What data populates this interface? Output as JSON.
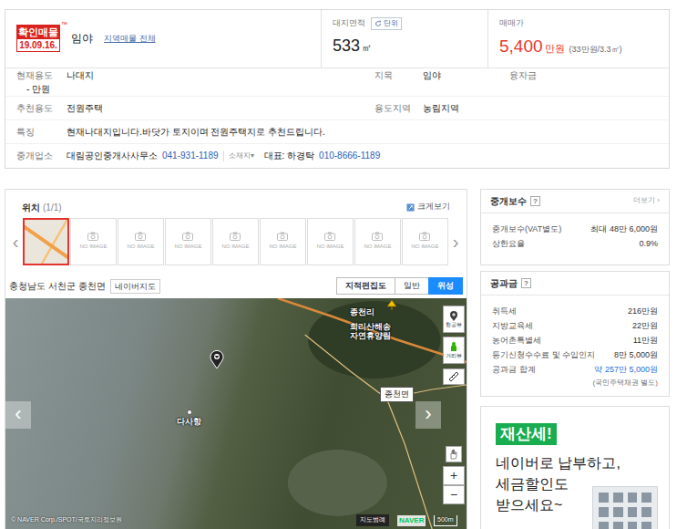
{
  "listing": {
    "badge_title": "확인매물",
    "badge_tm": "™",
    "badge_date": "19.09.16.",
    "type": "임야",
    "area_link": "지역매물 전체",
    "area_label": "대지면적",
    "unit_button": "단위",
    "area_value": "533",
    "area_unit": "㎡",
    "price_label": "매매가",
    "price_value": "5,400",
    "price_unit": "만원",
    "price_per": "(33만원/3.3㎡)"
  },
  "details": {
    "rows": [
      {
        "kind": "pairs",
        "cells": [
          {
            "label": "현재용도",
            "value": "나대지"
          },
          {
            "label": "지목",
            "value": "임야"
          },
          {
            "label": "융자금",
            "value": "- 만원"
          }
        ]
      },
      {
        "kind": "pairs",
        "cells": [
          {
            "label": "추천용도",
            "value": "전원주택"
          },
          {
            "label": "용도지역",
            "value": "농림지역"
          }
        ]
      },
      {
        "kind": "text",
        "label": "특징",
        "value": "현재나대지입니다.바닷가 토지이며 전원주택지로 추천드립니다."
      },
      {
        "kind": "agency",
        "label": "중개업소",
        "name": "대림공인중개사사무소",
        "phone": "041-931-1189",
        "location": "소재지",
        "location_arrow": "▾",
        "rep": "대표: 하경탁",
        "rep_phone": "010-8666-1189"
      }
    ]
  },
  "location": {
    "title": "위치",
    "count": "(1/1)",
    "enlarge": "크게보기",
    "prev": "‹",
    "next": "›",
    "thumbnails": [
      {
        "kind": "map",
        "selected": true
      },
      {
        "kind": "empty",
        "label": "NO IMAGE",
        "selected": false
      },
      {
        "kind": "empty",
        "label": "NO IMAGE",
        "selected": false
      },
      {
        "kind": "empty",
        "label": "NO IMAGE",
        "selected": false
      },
      {
        "kind": "empty",
        "label": "NO IMAGE",
        "selected": false
      },
      {
        "kind": "empty",
        "label": "NO IMAGE",
        "selected": false
      },
      {
        "kind": "empty",
        "label": "NO IMAGE",
        "selected": false
      },
      {
        "kind": "empty",
        "label": "NO IMAGE",
        "selected": false
      },
      {
        "kind": "empty",
        "label": "NO IMAGE",
        "selected": false
      }
    ],
    "address": "충청남도 서천군 종천면",
    "naver_map": "네이버지도",
    "map_types": [
      {
        "label": "지적편집도",
        "selected": false
      },
      {
        "label": "일반",
        "selected": false
      },
      {
        "label": "위성",
        "selected": true
      }
    ]
  },
  "map": {
    "labels": {
      "village": "종천리",
      "forest": "희리산해송 자연휴양림",
      "port": "다사항",
      "district": "종천면"
    },
    "tools": {
      "aerial": "항공뷰",
      "street": "거리뷰",
      "zoom_in": "+",
      "zoom_out": "−"
    },
    "prev": "‹",
    "next": "›",
    "copyright": "© NAVER Corp./SPOT/국토지리정보원",
    "legend": "지도범례",
    "logo": "NAVER",
    "scale": "500m"
  },
  "fee": {
    "title": "중개보수",
    "help": "?",
    "more": "더보기 ›",
    "rows": [
      {
        "label": "중개보수(VAT별도)",
        "value": "최대 48만 6,000원"
      },
      {
        "label": "상한요율",
        "value": "0.9%"
      }
    ]
  },
  "tax": {
    "title": "공과금",
    "help": "?",
    "rows": [
      {
        "kind": "item",
        "label": "취득세",
        "value": "216만원"
      },
      {
        "kind": "item",
        "label": "지방교육세",
        "value": "22만원"
      },
      {
        "kind": "item",
        "label": "농어촌특별세",
        "value": "11만원"
      },
      {
        "kind": "item",
        "label": "등기신청수수료 및 수입인지",
        "value": "8만 5,000원"
      },
      {
        "kind": "total",
        "label": "공과금 합계",
        "value": "약 257만 5,000원"
      }
    ],
    "note": "(국민주택채권 별도)"
  },
  "ad": {
    "tag": "재산세!",
    "lines": [
      "네이버로 납부하고,",
      "세금할인도",
      "받으세요~"
    ]
  }
}
